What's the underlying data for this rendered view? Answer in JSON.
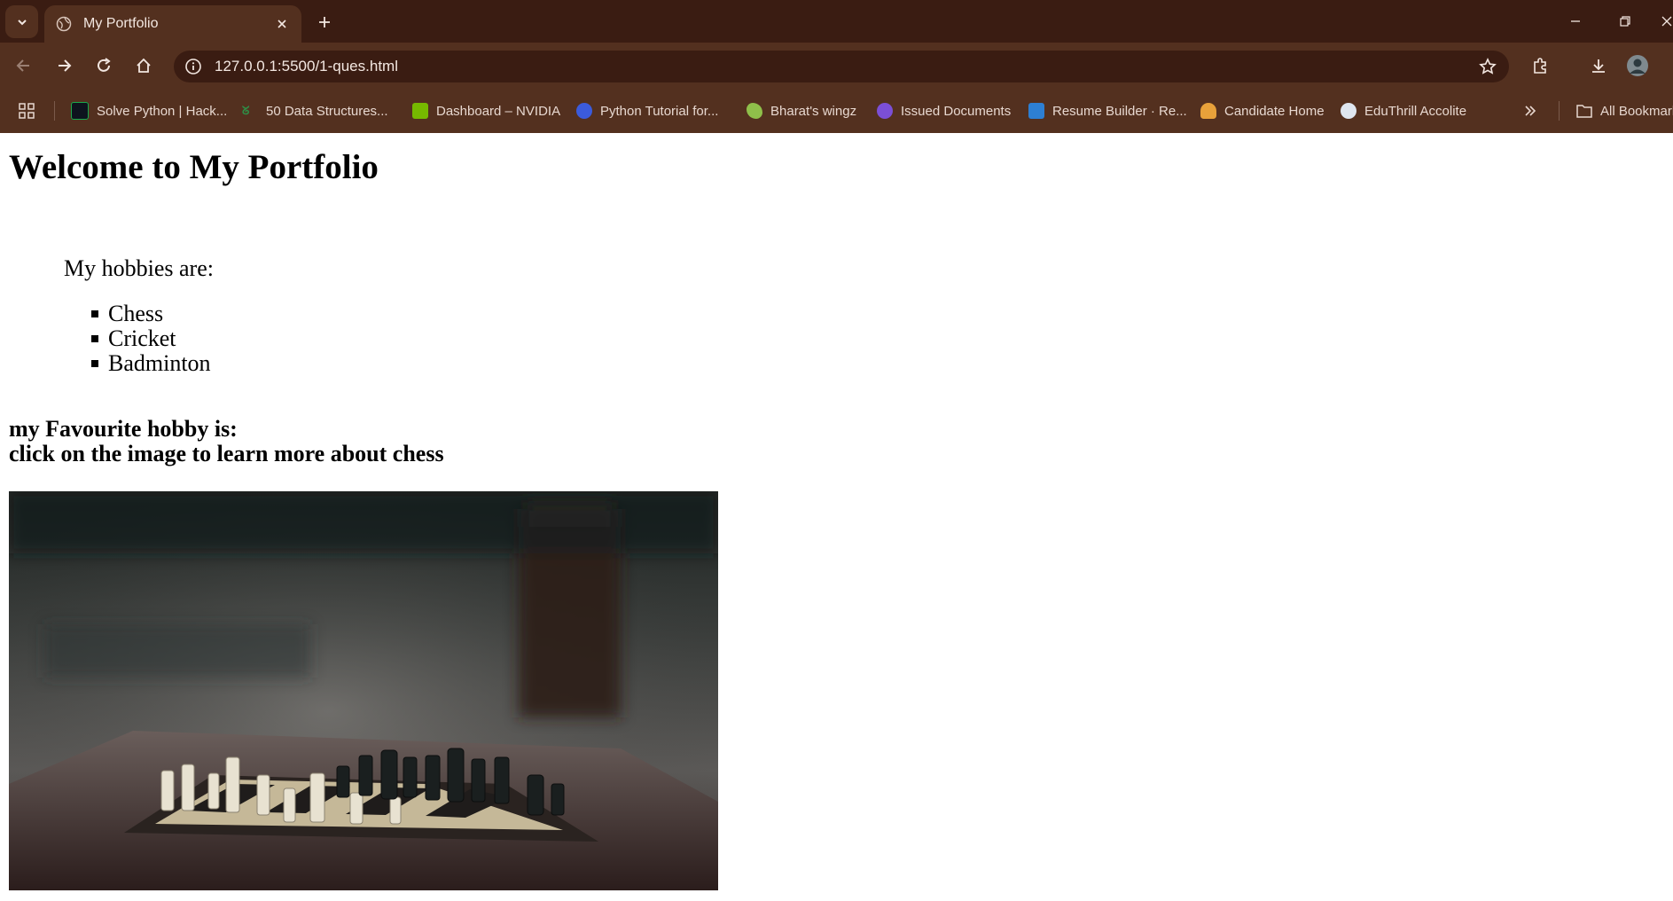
{
  "browser": {
    "tab_title": "My Portfolio",
    "url": "127.0.0.1:5500/1-ques.html",
    "bookmarks": [
      {
        "label": "Solve Python | Hack...",
        "icon": "hackerrank-icon",
        "color": "#1ba94c"
      },
      {
        "label": "50 Data Structures...",
        "icon": "geeksforgeeks-icon",
        "color": "#2f8d46"
      },
      {
        "label": "Dashboard – NVIDIA",
        "icon": "nvidia-icon",
        "color": "#76b900"
      },
      {
        "label": "Python Tutorial for...",
        "icon": "python-tutorial-icon",
        "color": "#3b5bdb"
      },
      {
        "label": "Bharat's wingz",
        "icon": "wingz-icon",
        "color": "#8fbf4a"
      },
      {
        "label": "Issued Documents",
        "icon": "digilocker-icon",
        "color": "#7b4fd6"
      },
      {
        "label": "Resume Builder · Re...",
        "icon": "resume-builder-icon",
        "color": "#2d7fd3"
      },
      {
        "label": "Candidate Home",
        "icon": "candidate-home-icon",
        "color": "#e8a13a"
      },
      {
        "label": "EduThrill Accolite",
        "icon": "eduthrill-icon",
        "color": "#dfe6ef"
      }
    ],
    "all_bookmarks_label": "All Bookmarks"
  },
  "page": {
    "heading": "Welcome to My Portfolio",
    "hobbies_intro": "My hobbies are:",
    "hobbies": [
      "Chess",
      "Cricket",
      "Badminton"
    ],
    "favourite_line": "my Favourite hobby is:",
    "click_line": "click on the image to learn more about chess"
  }
}
